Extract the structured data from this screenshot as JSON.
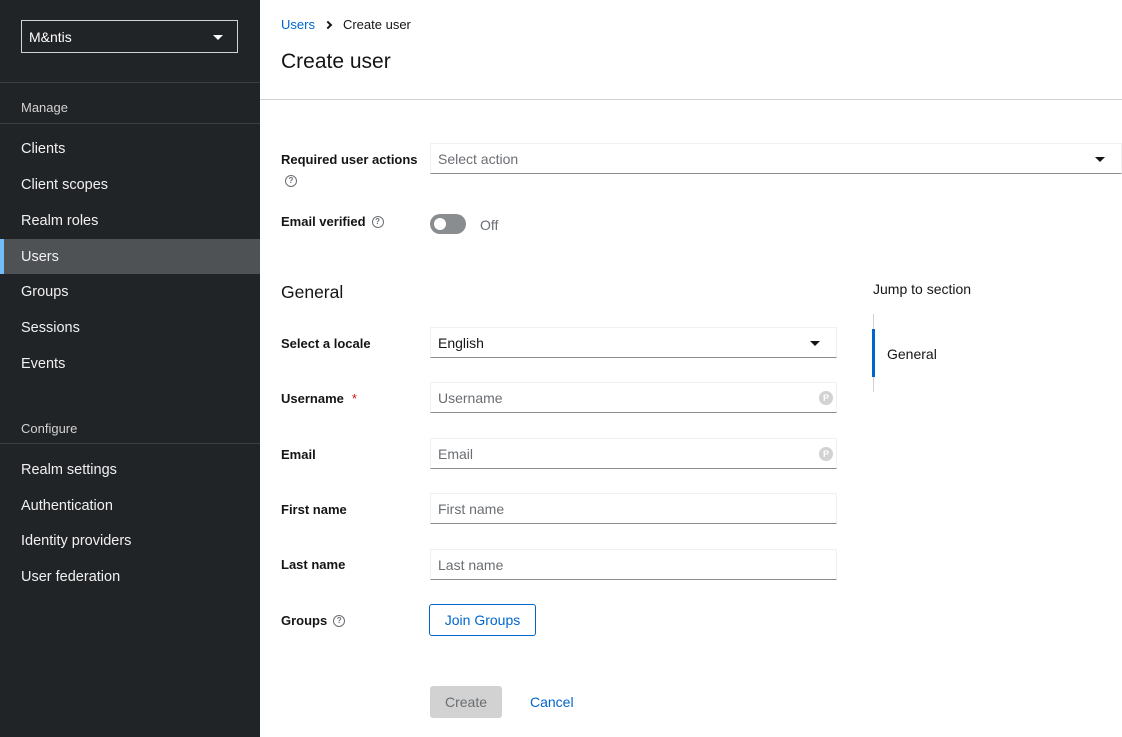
{
  "sidebar": {
    "realm": "M&ntis",
    "sections": {
      "manage": "Manage",
      "configure": "Configure"
    },
    "manage_items": [
      {
        "label": "Clients"
      },
      {
        "label": "Client scopes"
      },
      {
        "label": "Realm roles"
      },
      {
        "label": "Users"
      },
      {
        "label": "Groups"
      },
      {
        "label": "Sessions"
      },
      {
        "label": "Events"
      }
    ],
    "configure_items": [
      {
        "label": "Realm settings"
      },
      {
        "label": "Authentication"
      },
      {
        "label": "Identity providers"
      },
      {
        "label": "User federation"
      }
    ],
    "active_item": "Users"
  },
  "header": {
    "breadcrumb": {
      "parent": "Users",
      "current": "Create user"
    },
    "title": "Create user"
  },
  "form": {
    "required_actions": {
      "label": "Required user actions",
      "placeholder": "Select action"
    },
    "email_verified": {
      "label": "Email verified",
      "state": "Off"
    },
    "general_title": "General",
    "locale": {
      "label": "Select a locale",
      "value": "English"
    },
    "username": {
      "label": "Username",
      "required_mark": "*",
      "placeholder": "Username"
    },
    "email": {
      "label": "Email",
      "placeholder": "Email"
    },
    "first_name": {
      "label": "First name",
      "placeholder": "First name"
    },
    "last_name": {
      "label": "Last name",
      "placeholder": "Last name"
    },
    "groups": {
      "label": "Groups",
      "button": "Join Groups"
    },
    "actions": {
      "create": "Create",
      "cancel": "Cancel"
    }
  },
  "jump_to": {
    "title": "Jump to section",
    "items": [
      {
        "label": "General"
      }
    ]
  },
  "colors": {
    "sidebar_bg": "#212427",
    "active_item_bg": "#4f5255",
    "active_accent": "#73bcf7",
    "link": "#0066cc",
    "required": "#c9190b"
  },
  "icons": {
    "help": "help-circle-icon",
    "password_manager": "password-manager-icon",
    "caret": "caret-down-icon",
    "breadcrumb_sep": "chevron-right-icon"
  }
}
